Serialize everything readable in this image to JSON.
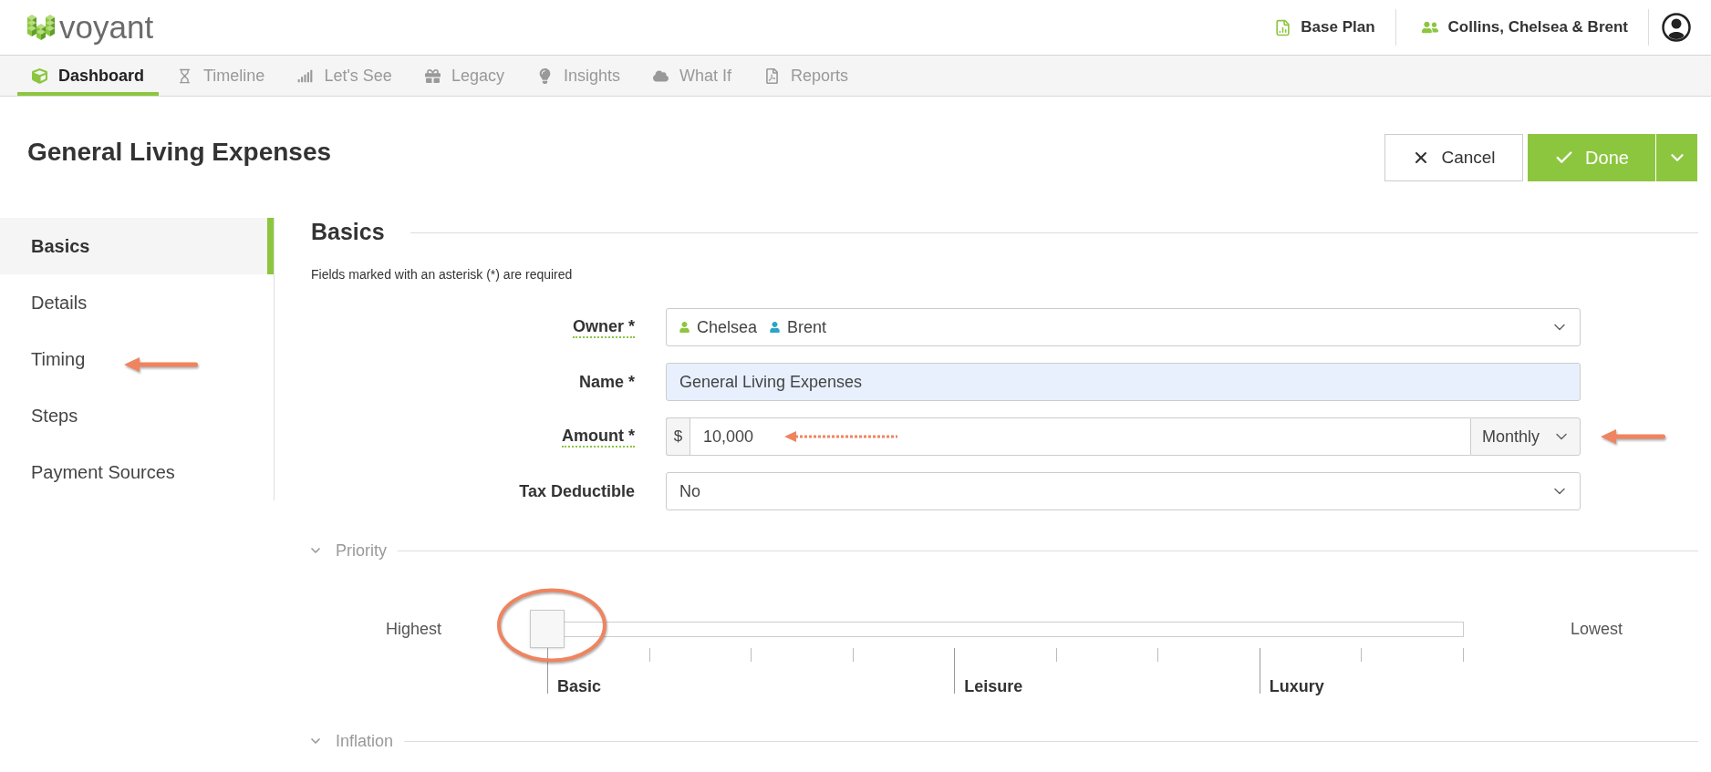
{
  "header": {
    "logo_text": "voyant",
    "plan": "Base Plan",
    "client": "Collins, Chelsea & Brent"
  },
  "nav_tabs": [
    {
      "label": "Dashboard",
      "selected": true
    },
    {
      "label": "Timeline",
      "selected": false
    },
    {
      "label": "Let's See",
      "selected": false
    },
    {
      "label": "Legacy",
      "selected": false
    },
    {
      "label": "Insights",
      "selected": false
    },
    {
      "label": "What If",
      "selected": false
    },
    {
      "label": "Reports",
      "selected": false
    }
  ],
  "page": {
    "title": "General Living Expenses",
    "cancel": "Cancel",
    "done": "Done"
  },
  "sidebar": {
    "items": [
      {
        "label": "Basics",
        "selected": true
      },
      {
        "label": "Details",
        "selected": false
      },
      {
        "label": "Timing",
        "selected": false
      },
      {
        "label": "Steps",
        "selected": false
      },
      {
        "label": "Payment Sources",
        "selected": false
      }
    ]
  },
  "basics": {
    "title": "Basics",
    "note": "Fields marked with an asterisk (*) are required",
    "fields": [
      {
        "kind": "people",
        "label": "Owner *",
        "has_help": true,
        "people": [
          {
            "name": "Chelsea",
            "color": "#8cc63f"
          },
          {
            "name": "Brent",
            "color": "#2aa5c8"
          }
        ]
      },
      {
        "kind": "text",
        "label": "Name *",
        "has_help": false,
        "value": "General Living Expenses",
        "autofilled": true
      },
      {
        "kind": "amount",
        "label": "Amount *",
        "has_help": true,
        "prefix": "$",
        "value": "10,000",
        "frequency": "Monthly"
      },
      {
        "kind": "select",
        "label": "Tax Deductible",
        "has_help": false,
        "value": "No"
      }
    ]
  },
  "priority": {
    "title": "Priority",
    "slider": {
      "min_label": "Highest",
      "max_label": "Lowest",
      "level": 0,
      "ticks": [
        {
          "kind": "major",
          "label": "Basic"
        },
        {
          "kind": "minor"
        },
        {
          "kind": "minor"
        },
        {
          "kind": "minor"
        },
        {
          "kind": "major",
          "label": "Leisure"
        },
        {
          "kind": "minor"
        },
        {
          "kind": "minor"
        },
        {
          "kind": "major",
          "label": "Luxury"
        },
        {
          "kind": "minor"
        },
        {
          "kind": "minor"
        }
      ]
    }
  },
  "inflation": {
    "title": "Inflation"
  }
}
